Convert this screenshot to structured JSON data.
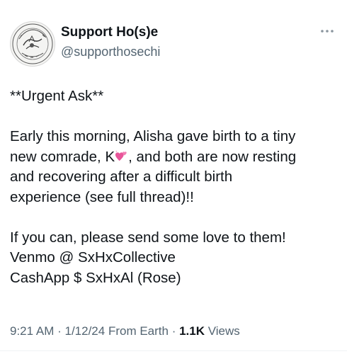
{
  "author": {
    "display_name": "Support Ho(s)e",
    "handle": "@supporthosechi",
    "avatar_icon": "circular-sketch-logo-icon"
  },
  "more_icon": "more-options-icon",
  "post": {
    "heading": "**Urgent Ask**",
    "para1_line1": "Early this morning, Alisha gave birth to a tiny",
    "para1_line2_before": "new comrade, K",
    "para1_line2_after": ", and both are now resting",
    "para1_line3": "and recovering after a difficult birth",
    "para1_line4": "experience (see full thread)!!",
    "para2_line1": "If you can, please send some love to them!",
    "para2_line2": "Venmo @ SxHxCollective",
    "para2_line3": "CashApp $ SxHxAl (Rose)",
    "emoji_icon": "two-hearts-icon"
  },
  "meta": {
    "time": "9:21 AM",
    "sep1": " · ",
    "date": "1/12/24",
    "location": " From Earth",
    "sep2": " · ",
    "views_count": "1.1K",
    "views_label": " Views"
  },
  "colors": {
    "text_primary": "#0f1419",
    "text_secondary": "#536471",
    "heart": "#e8559a"
  }
}
